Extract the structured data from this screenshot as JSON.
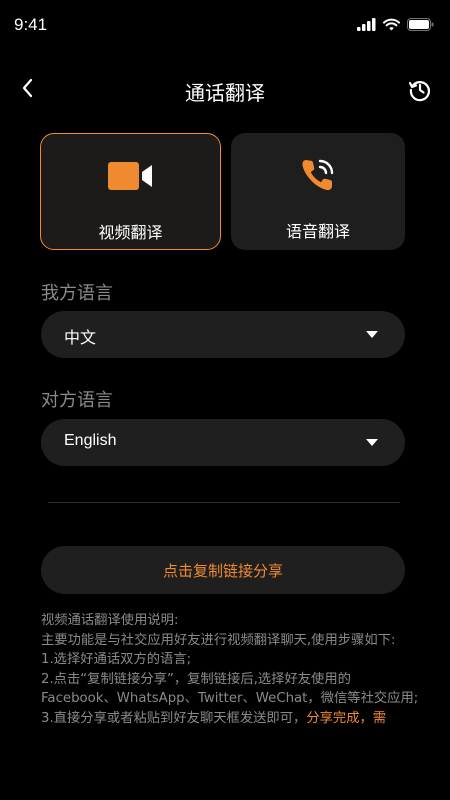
{
  "status_bar": {
    "time": "9:41",
    "icons": [
      "cellular-signal-icon",
      "wifi-icon",
      "battery-icon"
    ]
  },
  "nav": {
    "title": "通话翻译",
    "back_icon": "chevron-left-icon",
    "history_icon": "history-icon"
  },
  "modes": [
    {
      "label": "视频翻译",
      "icon": "video-camera-icon",
      "selected": true
    },
    {
      "label": "语音翻译",
      "icon": "phone-call-icon",
      "selected": false
    }
  ],
  "my_language": {
    "label": "我方语言",
    "value": "中文"
  },
  "their_language": {
    "label": "对方语言",
    "value": "English"
  },
  "share_button": {
    "label": "点击复制链接分享"
  },
  "instructions": {
    "title": "视频通话翻译使用说明:",
    "intro": "主要功能是与社交应用好友进行视频翻译聊天,使用步骤如下:",
    "step1": "1.选择好通话双方的语言;",
    "step2": "2.点击“复制链接分享”，复制链接后,选择好友使用的Facebook、WhatsApp、Twitter、WeChat，微信等社交应用;",
    "step3_prefix": "3.直接分享或者粘贴到好友聊天框发送即可，",
    "step3_highlight": "分享完成，需"
  },
  "colors": {
    "accent": "#f08a31",
    "background": "#000000",
    "card": "#1e1e1e",
    "muted_text": "#8a8a8a"
  }
}
